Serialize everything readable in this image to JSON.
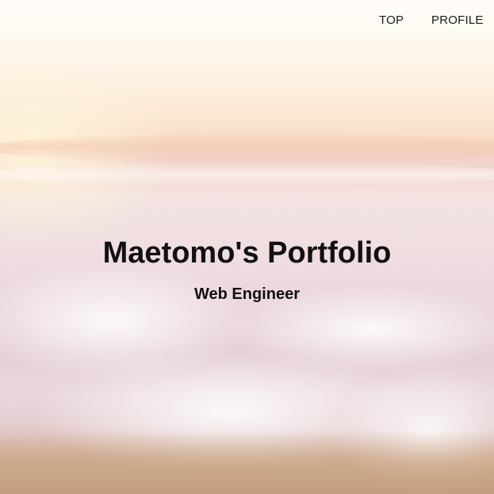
{
  "nav": {
    "items": [
      {
        "label": "TOP"
      },
      {
        "label": "PROFILE"
      }
    ]
  },
  "hero": {
    "title": "Maetomo's Portfolio",
    "subtitle": "Web Engineer",
    "background_image": "beach-waves-photo"
  }
}
